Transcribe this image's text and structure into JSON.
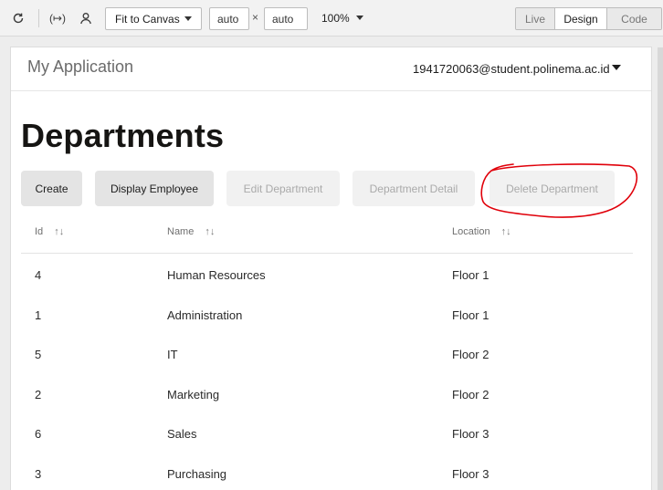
{
  "toolbar": {
    "fit_label": "Fit to Canvas",
    "width_value": "auto",
    "height_value": "auto",
    "times": "×",
    "zoom": "100%",
    "modes": [
      {
        "label": "Live",
        "active": false
      },
      {
        "label": "Design",
        "active": true
      },
      {
        "label": "Code",
        "active": false
      }
    ]
  },
  "header": {
    "app_title": "My Application",
    "user_email": "1941720063@student.polinema.ac.id"
  },
  "page": {
    "title": "Departments"
  },
  "actions": [
    {
      "label": "Create",
      "enabled": true
    },
    {
      "label": "Display Employee",
      "enabled": true
    },
    {
      "label": "Edit Department",
      "enabled": false
    },
    {
      "label": "Department Detail",
      "enabled": false
    },
    {
      "label": "Delete Department",
      "enabled": false
    }
  ],
  "annotation_color": "#e0000a",
  "table": {
    "columns": [
      "Id",
      "Name",
      "Location"
    ],
    "sort_icon": "↑↓",
    "rows": [
      {
        "id": "4",
        "name": "Human Resources",
        "location": "Floor 1"
      },
      {
        "id": "1",
        "name": "Administration",
        "location": "Floor 1"
      },
      {
        "id": "5",
        "name": "IT",
        "location": "Floor 2"
      },
      {
        "id": "2",
        "name": "Marketing",
        "location": "Floor 2"
      },
      {
        "id": "6",
        "name": "Sales",
        "location": "Floor 3"
      },
      {
        "id": "3",
        "name": "Purchasing",
        "location": "Floor 3"
      }
    ]
  }
}
